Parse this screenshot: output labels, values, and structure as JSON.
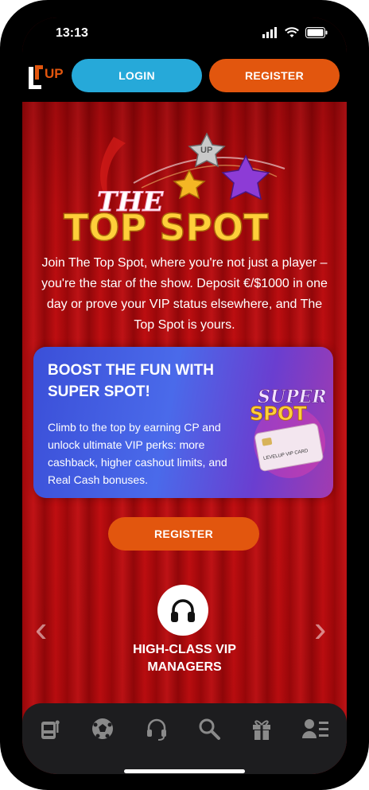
{
  "status_bar": {
    "time": "13:13"
  },
  "header": {
    "logo_text": "UP",
    "login_label": "LOGIN",
    "register_label": "REGISTER"
  },
  "hero": {
    "title_line1": "THE",
    "title_line2": "TOP SPOT",
    "badge_text": "UP",
    "description": "Join The Top Spot, where you're not just a player – you're the star of the show. Deposit €/$1000 in one day or prove your VIP status elsewhere, and The Top Spot is yours."
  },
  "promo_card": {
    "title": "BOOST THE FUN WITH SUPER SPOT!",
    "body": "Climb to the top by earning CP and unlock ultimate VIP perks: more cashback, higher cashout limits, and Real Cash bonuses.",
    "art_line1": "SUPER",
    "art_line2": "SPOT",
    "card_text": "LEVELUP VIP CARD"
  },
  "register_button": {
    "label": "REGISTER"
  },
  "carousel": {
    "feature_icon": "headphones-icon",
    "feature_label": "HIGH-CLASS VIP MANAGERS"
  },
  "bottom_nav": {
    "items": [
      "slot-machine-icon",
      "soccer-ball-icon",
      "headset-icon",
      "search-icon",
      "gift-icon",
      "profile-list-icon"
    ]
  },
  "colors": {
    "login": "#26a9d9",
    "register": "#e2560e",
    "background_red": "#c10a0d",
    "title_gold": "#ffcf3a"
  }
}
